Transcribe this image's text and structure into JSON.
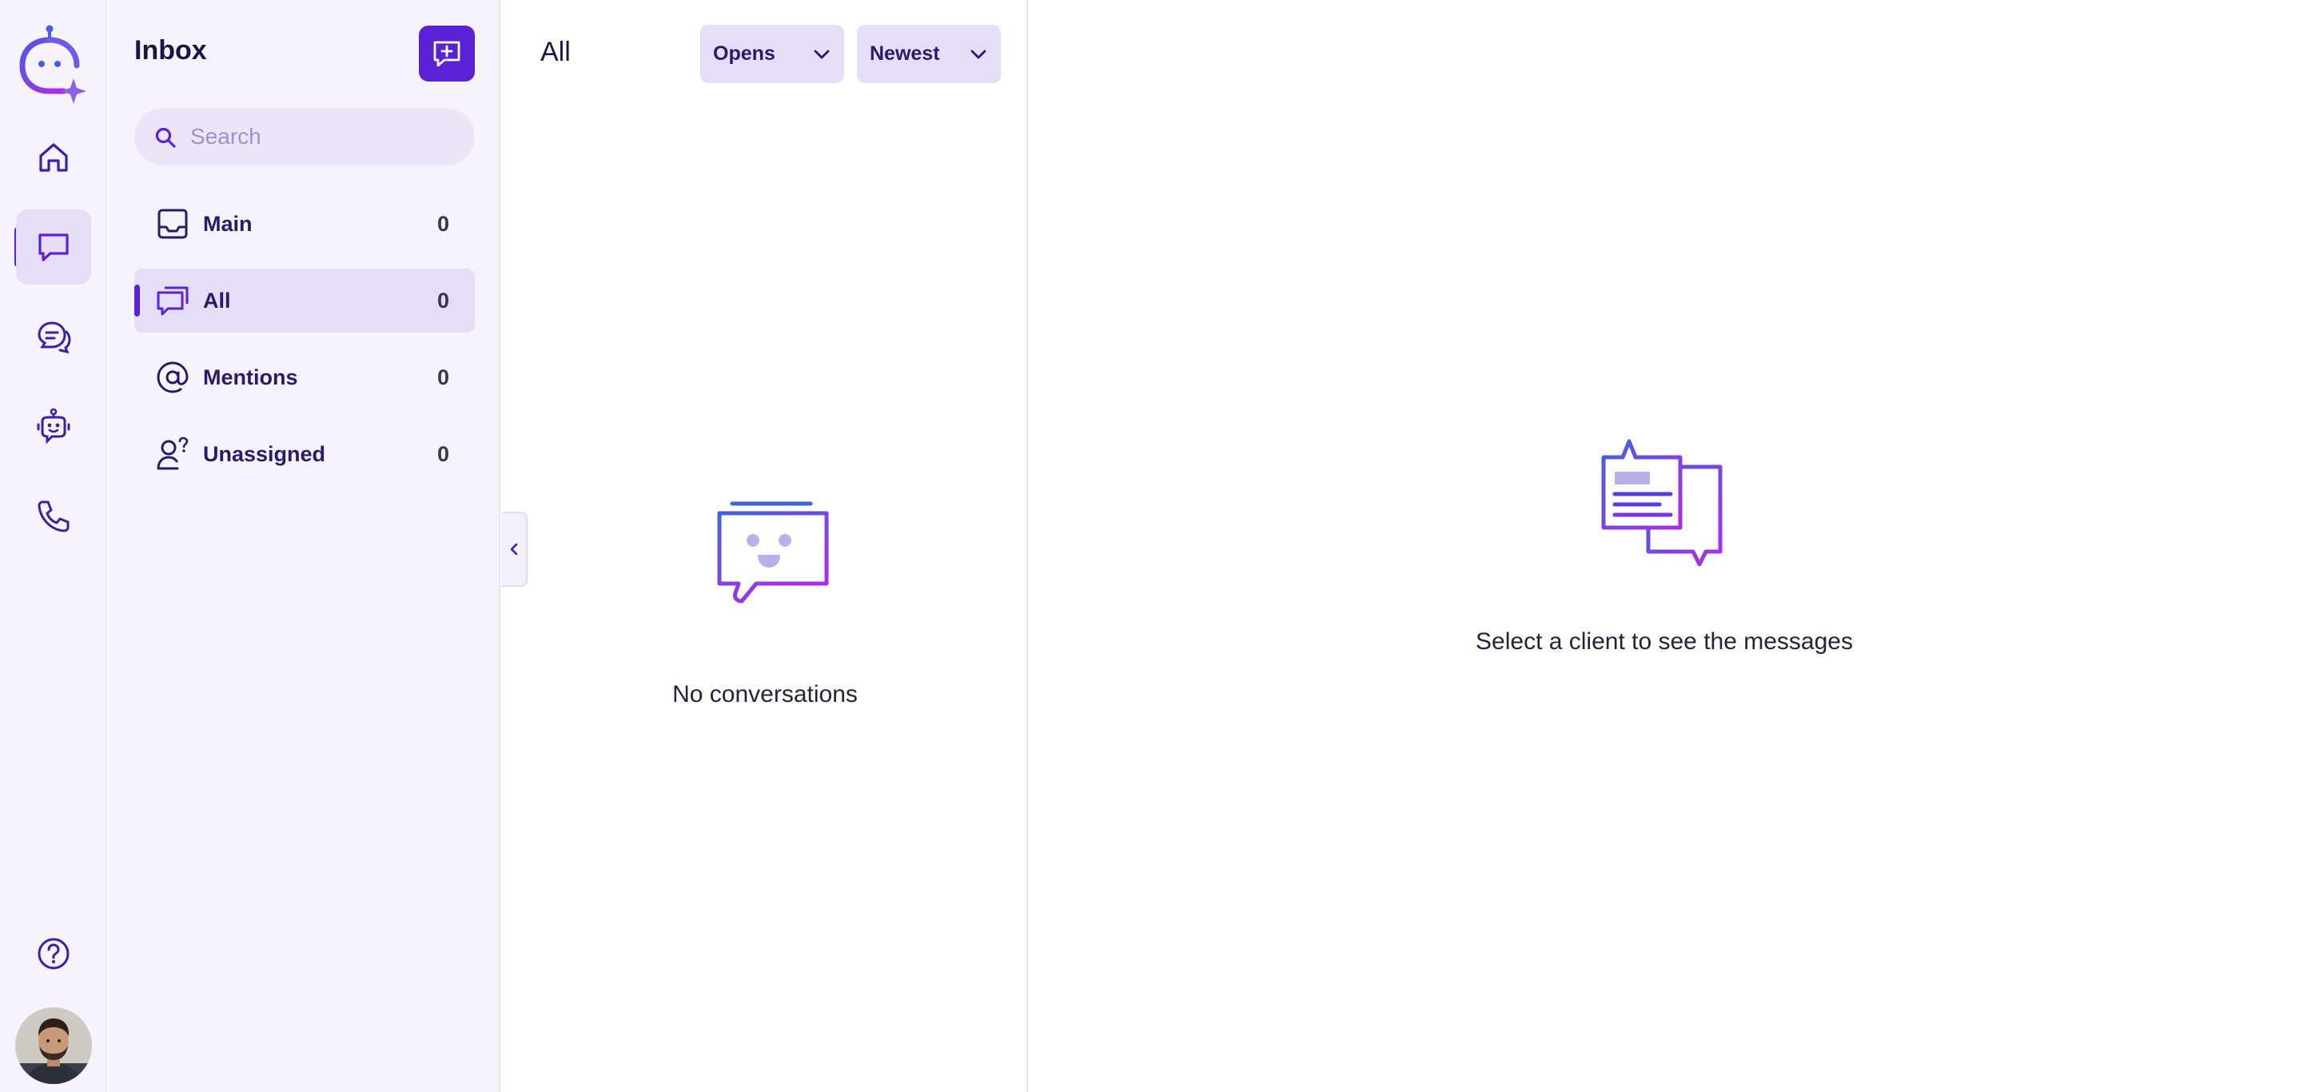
{
  "rail": {
    "items": [
      {
        "icon": "home-icon"
      },
      {
        "icon": "chat-bubble-icon",
        "active": true
      },
      {
        "icon": "conversation-icon"
      },
      {
        "icon": "bot-icon"
      },
      {
        "icon": "phone-icon"
      }
    ],
    "help_icon": "help-icon",
    "avatar": "user-avatar"
  },
  "inbox": {
    "title": "Inbox",
    "compose_icon": "new-message-icon",
    "search": {
      "placeholder": "Search",
      "value": ""
    },
    "items": [
      {
        "label": "Main",
        "count": "0",
        "icon": "inbox-tray-icon"
      },
      {
        "label": "All",
        "count": "0",
        "icon": "chat-stack-icon",
        "active": true
      },
      {
        "label": "Mentions",
        "count": "0",
        "icon": "at-sign-icon"
      },
      {
        "label": "Unassigned",
        "count": "0",
        "icon": "user-question-icon"
      }
    ]
  },
  "conversations": {
    "title": "All",
    "status_filter": "Opens",
    "sort_filter": "Newest",
    "empty_text": "No conversations"
  },
  "messages": {
    "empty_text": "Select a client to see the messages"
  },
  "colors": {
    "accent": "#5b21d6",
    "panel_bg": "#f6f3fc",
    "active_bg": "#e6def8",
    "gradient_start": "#3f63e0",
    "gradient_end": "#b02ae8"
  }
}
